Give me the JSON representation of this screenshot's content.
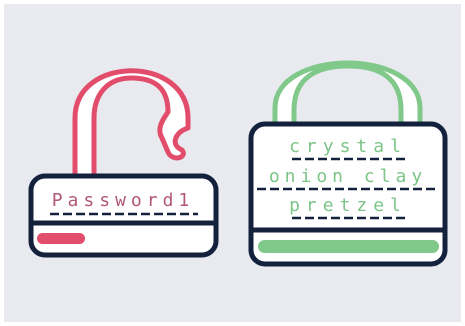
{
  "weak_lock": {
    "password": "Password1",
    "strength": 0.25,
    "color": "#e34d6c",
    "text_color": "#b15878"
  },
  "strong_lock": {
    "passphrase_lines": [
      "crystal",
      "onion clay",
      "pretzel"
    ],
    "strength": 1.0,
    "color": "#80c98a",
    "text_color": "#7cc488"
  },
  "outline_color": "#14213d",
  "background_color": "#e9eaef"
}
